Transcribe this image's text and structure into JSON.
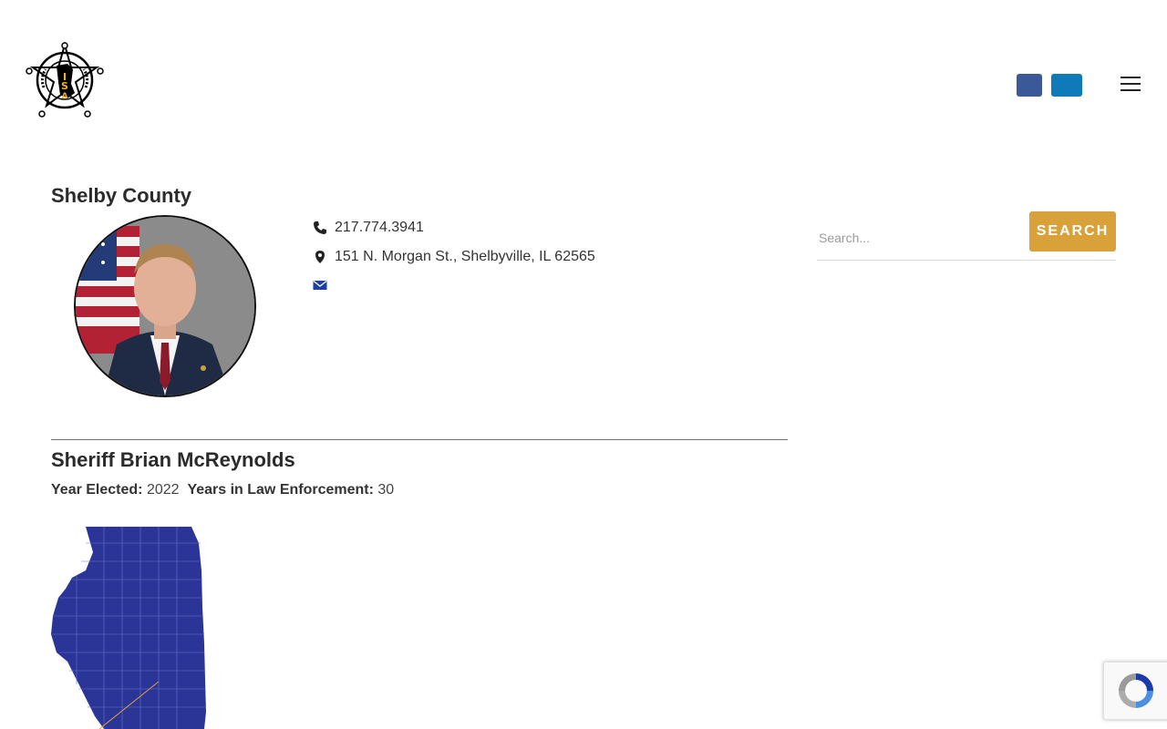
{
  "header": {
    "logo_text_top": "ILLINOIS SHERIFFS'",
    "logo_letters": "ISA",
    "logo_text_bottom": "ASSOCIATION",
    "social": [
      {
        "icon": "facebook-icon",
        "color": "#3b5998"
      },
      {
        "icon": "linkedin-icon",
        "color": "#0e7ab8"
      }
    ],
    "menu_icon": "hamburger-menu-icon"
  },
  "county": {
    "title": "Shelby County",
    "phone": "217.774.3941",
    "address": "151 N. Morgan St., Shelbyville, IL 62565",
    "phone_icon": "phone-icon",
    "address_icon": "map-marker-icon",
    "email_icon": "envelope-icon"
  },
  "sheriff": {
    "name": "Sheriff Brian McReynolds",
    "year_elected_label": "Year Elected:",
    "year_elected": "2022",
    "years_le_label": "Years in Law Enforcement:",
    "years_le": "30"
  },
  "search": {
    "placeholder": "Search...",
    "button_label": "SEARCH"
  },
  "colors": {
    "map_fill": "#2a3597",
    "accent": "#d8a13a",
    "email_icon": "#1a3fa8"
  }
}
